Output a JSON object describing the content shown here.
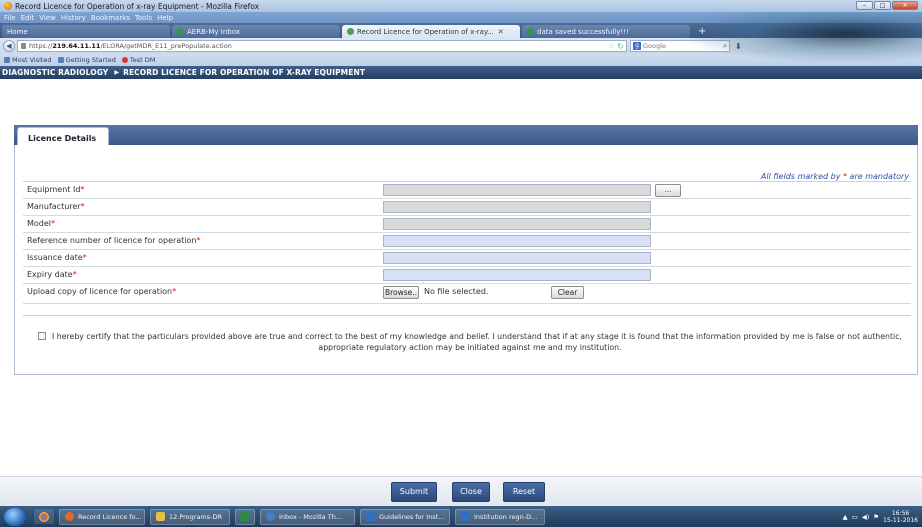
{
  "window": {
    "title": "Record Licence for Operation of x-ray Equipment - Mozilla Firefox",
    "controls": [
      "–",
      "□",
      "✕"
    ]
  },
  "menu": [
    "File",
    "Edit",
    "View",
    "History",
    "Bookmarks",
    "Tools",
    "Help"
  ],
  "tabs": [
    {
      "label": "Home"
    },
    {
      "label": "AERB-My Inbox"
    },
    {
      "label": "Record Licence for Operation of x-ray..."
    },
    {
      "label": "data saved successfully!!!"
    }
  ],
  "nav": {
    "url_prefix": "https://",
    "url_host": "219.64.11.11",
    "url_path": "/ELORA/getMDR_E11_prePopulate.action",
    "search_placeholder": "Google"
  },
  "bookmarks": [
    "Most Visited",
    "Getting Started",
    "Test DM"
  ],
  "header": {
    "section": "DIAGNOSTIC RADIOLOGY",
    "page": "RECORD LICENCE FOR OPERATION OF X-RAY EQUIPMENT"
  },
  "form": {
    "tab_label": "Licence Details",
    "mandatory_note_prefix": "All fields marked by ",
    "mandatory_note_suffix": " are mandatory",
    "fields": [
      {
        "label": "Equipment Id",
        "value": ""
      },
      {
        "label": "Manufacturer",
        "value": ""
      },
      {
        "label": "Model",
        "value": ""
      },
      {
        "label": "Reference number of licence for operation",
        "value": ""
      },
      {
        "label": "Issuance date",
        "value": ""
      },
      {
        "label": "Expiry date",
        "value": ""
      },
      {
        "label": "Upload copy of licence for operation",
        "value": ""
      }
    ],
    "pick_button": "...",
    "browse_button": "Browse..",
    "no_file_text": "No file selected.",
    "clear_button": "Clear",
    "certify_text": "I hereby certify that the particulars provided above are true and correct to the best of my knowledge and belief. I understand that if at any stage it is found that the information provided by me is false or not authentic, appropriate regulatory action may be initiated against me and my institution."
  },
  "actions": {
    "submit": "Submit",
    "close": "Close",
    "reset": "Reset"
  },
  "taskbar": {
    "items": [
      {
        "label": "Record Licence fo...",
        "color": "#e06a20"
      },
      {
        "label": "12.Programs-DR",
        "color": "#e8c040"
      },
      {
        "label": "",
        "color": "#2e8a3e"
      },
      {
        "label": "Inbox - Mozilla Th...",
        "color": "#3f7fc8"
      },
      {
        "label": "Guidelines for Inst...",
        "color": "#2f6fc0"
      },
      {
        "label": "Institution regn-D...",
        "color": "#2f6fc0"
      }
    ],
    "time": "16:56",
    "date": "15-11-2016"
  }
}
